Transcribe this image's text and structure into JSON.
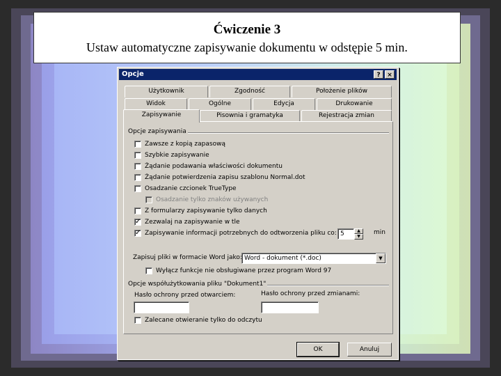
{
  "slide": {
    "title": "Ćwiczenie 3",
    "subtitle": "Ustaw automatyczne zapisywanie dokumentu w odstępie 5 min."
  },
  "dialog": {
    "title": "Opcje",
    "help_glyph": "?",
    "close_glyph": "×",
    "tabs_row1": [
      "Użytkownik",
      "Zgodność",
      "Położenie plików"
    ],
    "tabs_row2": [
      "Widok",
      "Ogólne",
      "Edycja",
      "Drukowanie"
    ],
    "tabs_row3": [
      "Zapisywanie",
      "Pisownia i gramatyka",
      "Rejestracja zmian"
    ],
    "active_tab": "Zapisywanie",
    "save_options_group": "Opcje zapisywania",
    "options": [
      {
        "label": "Zawsze z kopią zapasową",
        "checked": "",
        "enabled": true
      },
      {
        "label": "Szybkie zapisywanie",
        "checked": "",
        "enabled": true
      },
      {
        "label": "Żądanie podawania właściwości dokumentu",
        "checked": "",
        "enabled": true
      },
      {
        "label": "Żądanie potwierdzenia zapisu szablonu Normal.dot",
        "checked": "",
        "enabled": true
      },
      {
        "label": "Osadzanie czcionek TrueType",
        "checked": "",
        "enabled": true
      },
      {
        "label": "Osadzanie tylko znaków używanych",
        "checked": "",
        "enabled": false
      },
      {
        "label": "Z formularzy zapisywanie tylko danych",
        "checked": "",
        "enabled": true
      },
      {
        "label": "Zezwalaj na zapisywanie w tle",
        "checked": "✓",
        "enabled": true
      },
      {
        "label": "Zapisywanie informacji potrzebnych do odtworzenia pliku co:",
        "checked": "✓",
        "enabled": true
      }
    ],
    "autosave_value": "5",
    "autosave_unit": "min",
    "spin_up": "▲",
    "spin_down": "▼",
    "save_format_label": "Zapisuj pliki w formacie Word jako:",
    "save_format_value": "Word - dokument (*.doc)",
    "dropdown_arrow": "▼",
    "disable_features_label": "Wyłącz funkcje nie obsługiwane przez program Word 97",
    "sharing_group": "Opcje współużytkowania pliku \"Dokument1\"",
    "open_password_label": "Hasło ochrony przed otwarciem:",
    "modify_password_label": "Hasło ochrony przed zmianami:",
    "open_password_value": "",
    "modify_password_value": "",
    "read_only_label": "Zalecane otwieranie tylko do odczytu",
    "ok_label": "OK",
    "cancel_label": "Anuluj"
  },
  "colors": {
    "titlebar": "#0a246a",
    "dialog_face": "#d4d0c8"
  }
}
